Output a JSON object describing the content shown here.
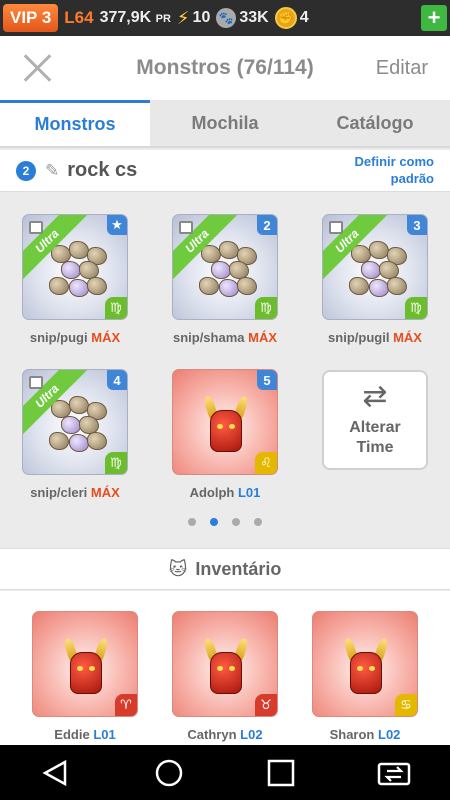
{
  "status_bar": {
    "vip": "VIP 3",
    "level": "L64",
    "power": "377,9K",
    "power_unit": "PR",
    "energy": "10",
    "paws": "33K",
    "coins": "4",
    "add_label": "+"
  },
  "header": {
    "title": "Monstros (76/114)",
    "edit_label": "Editar"
  },
  "tabs": [
    {
      "label": "Monstros",
      "active": true
    },
    {
      "label": "Mochila",
      "active": false
    },
    {
      "label": "Catálogo",
      "active": false
    }
  ],
  "team": {
    "number": "2",
    "name": "rock cs",
    "set_default_line1": "Definir como",
    "set_default_line2": "padrão"
  },
  "team_monsters": [
    {
      "badge": "★",
      "ribbon": "Ultra",
      "element": "♍",
      "name": "snip/pugi",
      "level": "MÁX"
    },
    {
      "badge": "2",
      "ribbon": "Ultra",
      "element": "♍",
      "name": "snip/shama",
      "level": "MÁX"
    },
    {
      "badge": "3",
      "ribbon": "Ultra",
      "element": "♍",
      "name": "snip/pugil",
      "level": "MÁX"
    },
    {
      "badge": "4",
      "ribbon": "Ultra",
      "element": "♍",
      "name": "snip/cleri",
      "level": "MÁX"
    },
    {
      "badge": "5",
      "ribbon": "",
      "element": "♌",
      "name": "Adolph",
      "level": "L01"
    }
  ],
  "swap_button": {
    "line1": "Alterar",
    "line2": "Time"
  },
  "pagination": {
    "pages": 4,
    "current": 2
  },
  "inventory": {
    "title": "Inventário",
    "items": [
      {
        "element": "♈",
        "name": "Eddie",
        "level": "L01"
      },
      {
        "element": "♉",
        "name": "Cathryn",
        "level": "L02"
      },
      {
        "element": "♋",
        "name": "Sharon",
        "level": "L02"
      }
    ]
  },
  "colors": {
    "accent": "#2a7ed8",
    "max_orange": "#e64d1f",
    "ultra_green": "#6fcb3d",
    "vip_orange": "#ff8a3d"
  }
}
